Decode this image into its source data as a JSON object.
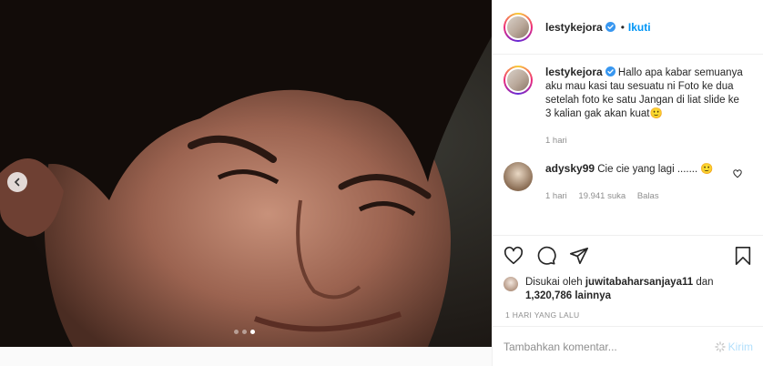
{
  "post": {
    "username": "lestykejora",
    "follow_label": "Ikuti",
    "separator": "•"
  },
  "caption": {
    "username": "lestykejora",
    "text": "Hallo apa kabar semuanya aku mau kasi tau sesuatu ni Foto ke dua setelah foto ke satu Jangan di liat slide ke 3 kalian gak akan kuat🙂",
    "time": "1 hari"
  },
  "reply": {
    "username": "adysky99",
    "text": "Cie cie yang lagi ....... 🙂",
    "time": "1 hari",
    "likes": "19.941 suka",
    "reply_label": "Balas"
  },
  "likes": {
    "prefix": "Disukai oleh",
    "user": "juwitabaharsanjaya11",
    "conj": "dan",
    "others": "1,320,786 lainnya"
  },
  "posted": "1 HARI YANG LALU",
  "add_comment": {
    "placeholder": "Tambahkan komentar...",
    "post_label": "Kirim"
  },
  "carousel": {
    "total": 3,
    "active": 2
  },
  "colors": {
    "accent": "#0095f6",
    "muted": "#8e8e8e",
    "text": "#262626",
    "disabled": "#b2dffc"
  },
  "icons": [
    "chevron-left-icon",
    "verified-badge-icon",
    "heart-icon",
    "comment-icon",
    "share-icon",
    "bookmark-icon"
  ]
}
